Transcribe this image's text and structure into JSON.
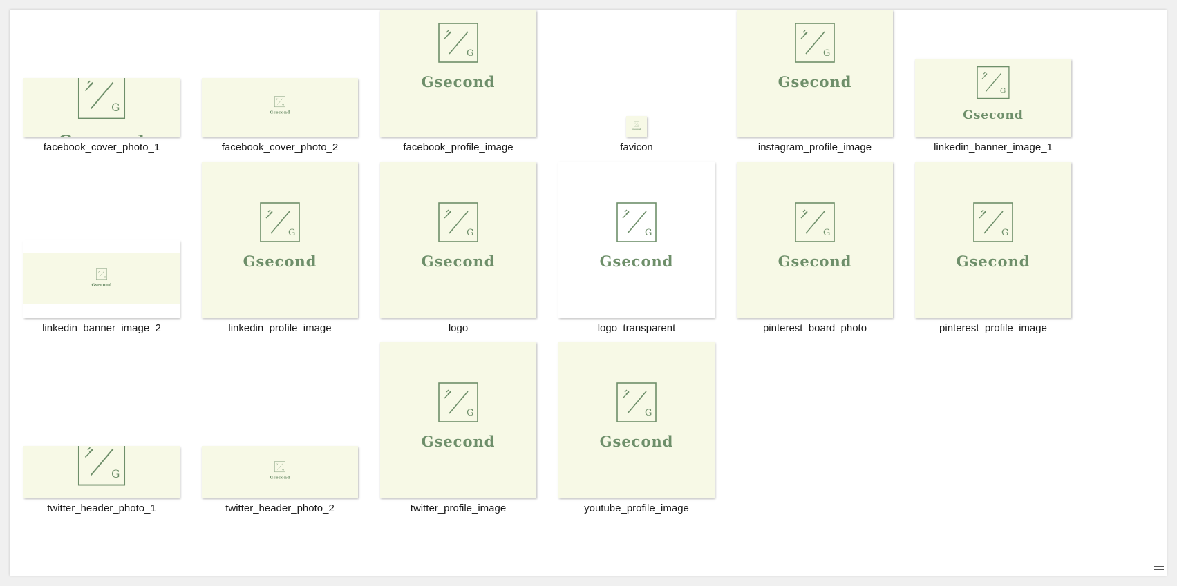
{
  "brand": {
    "name": "Gsecond",
    "monogram": "G",
    "green": "#6e8f6a",
    "cream": "#f7f9e6"
  },
  "files": [
    {
      "label": "facebook_cover_photo_1",
      "icon": "gsecond-logo-icon"
    },
    {
      "label": "facebook_cover_photo_2",
      "icon": "gsecond-logo-icon"
    },
    {
      "label": "facebook_profile_image",
      "icon": "gsecond-logo-icon"
    },
    {
      "label": "favicon",
      "icon": "gsecond-logo-icon"
    },
    {
      "label": "instagram_profile_image",
      "icon": "gsecond-logo-icon"
    },
    {
      "label": "linkedin_banner_image_1",
      "icon": "gsecond-logo-icon"
    },
    {
      "label": "linkedin_banner_image_2",
      "icon": "gsecond-logo-icon"
    },
    {
      "label": "linkedin_profile_image",
      "icon": "gsecond-logo-icon"
    },
    {
      "label": "logo",
      "icon": "gsecond-logo-icon"
    },
    {
      "label": "logo_transparent",
      "icon": "gsecond-logo-icon"
    },
    {
      "label": "pinterest_board_photo",
      "icon": "gsecond-logo-icon"
    },
    {
      "label": "pinterest_profile_image",
      "icon": "gsecond-logo-icon"
    },
    {
      "label": "twitter_header_photo_1",
      "icon": "gsecond-logo-icon"
    },
    {
      "label": "twitter_header_photo_2",
      "icon": "gsecond-logo-icon"
    },
    {
      "label": "twitter_profile_image",
      "icon": "gsecond-logo-icon"
    },
    {
      "label": "youtube_profile_image",
      "icon": "gsecond-logo-icon"
    }
  ]
}
